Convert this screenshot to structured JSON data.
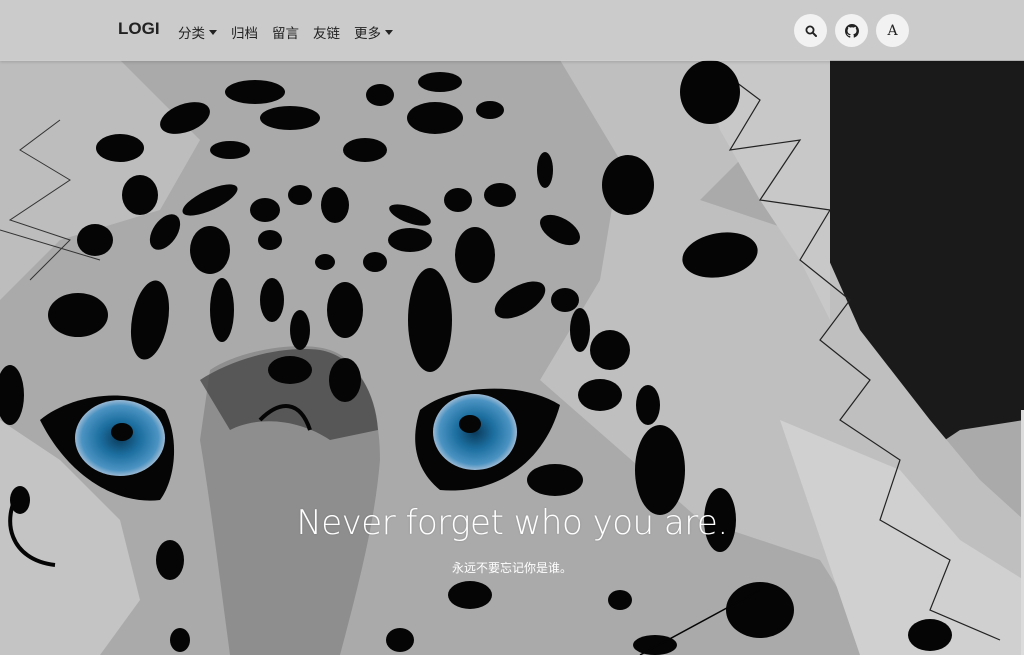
{
  "navbar": {
    "brand": "LOGI",
    "items": [
      {
        "label": "分类",
        "has_dropdown": true
      },
      {
        "label": "归档",
        "has_dropdown": false
      },
      {
        "label": "留言",
        "has_dropdown": false
      },
      {
        "label": "友链",
        "has_dropdown": false
      },
      {
        "label": "更多",
        "has_dropdown": true
      }
    ],
    "actions": {
      "search_icon": "search-icon",
      "github_icon": "github-icon",
      "font_label": "A"
    }
  },
  "hero": {
    "title": "Never forget who you are.",
    "subtitle": "永远不要忘记你是谁。",
    "background_image": "snow-leopard-illustration"
  },
  "colors": {
    "navbar_bg": "#d2d2d2",
    "eye_blue": "#1c6fa0",
    "dark_panel": "#1a1a1a"
  }
}
